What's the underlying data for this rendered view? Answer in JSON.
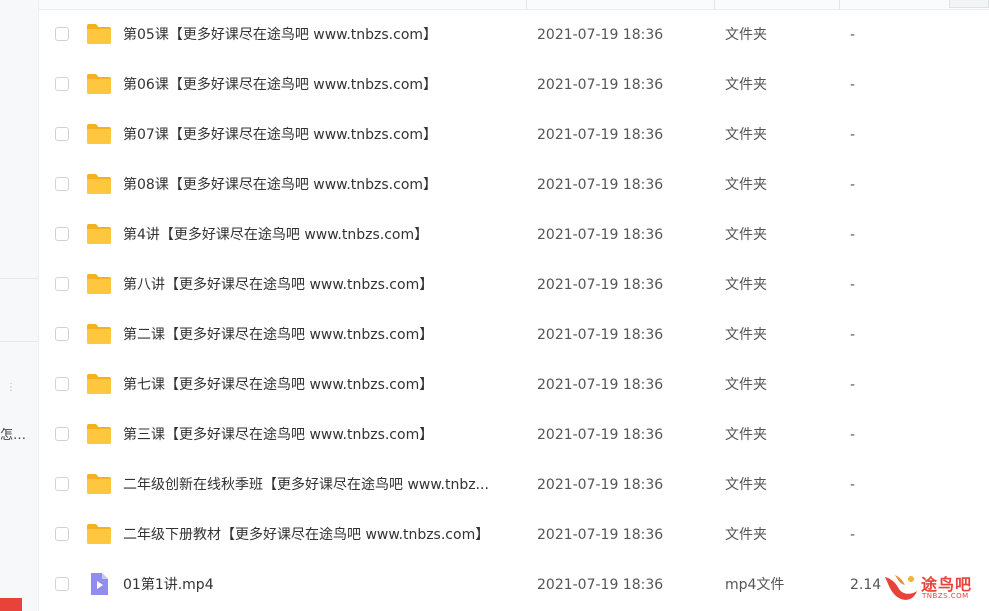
{
  "sidebar": {
    "truncated_text": "怎…"
  },
  "colors": {
    "folder": "#FFC63F",
    "folder_dark": "#F5B21E",
    "video": "#8F8DF0",
    "watermark": "#E8433A"
  },
  "files": [
    {
      "name": "第05课【更多好课尽在途鸟吧 www.tnbzs.com】",
      "date": "2021-07-19 18:36",
      "type": "文件夹",
      "size": "-",
      "icon": "folder-icon"
    },
    {
      "name": "第06课【更多好课尽在途鸟吧 www.tnbzs.com】",
      "date": "2021-07-19 18:36",
      "type": "文件夹",
      "size": "-",
      "icon": "folder-icon"
    },
    {
      "name": "第07课【更多好课尽在途鸟吧 www.tnbzs.com】",
      "date": "2021-07-19 18:36",
      "type": "文件夹",
      "size": "-",
      "icon": "folder-icon"
    },
    {
      "name": "第08课【更多好课尽在途鸟吧 www.tnbzs.com】",
      "date": "2021-07-19 18:36",
      "type": "文件夹",
      "size": "-",
      "icon": "folder-icon"
    },
    {
      "name": "第4讲【更多好课尽在途鸟吧 www.tnbzs.com】",
      "date": "2021-07-19 18:36",
      "type": "文件夹",
      "size": "-",
      "icon": "folder-icon"
    },
    {
      "name": "第八讲【更多好课尽在途鸟吧 www.tnbzs.com】",
      "date": "2021-07-19 18:36",
      "type": "文件夹",
      "size": "-",
      "icon": "folder-icon"
    },
    {
      "name": "第二课【更多好课尽在途鸟吧 www.tnbzs.com】",
      "date": "2021-07-19 18:36",
      "type": "文件夹",
      "size": "-",
      "icon": "folder-icon"
    },
    {
      "name": "第七课【更多好课尽在途鸟吧 www.tnbzs.com】",
      "date": "2021-07-19 18:36",
      "type": "文件夹",
      "size": "-",
      "icon": "folder-icon"
    },
    {
      "name": "第三课【更多好课尽在途鸟吧 www.tnbzs.com】",
      "date": "2021-07-19 18:36",
      "type": "文件夹",
      "size": "-",
      "icon": "folder-icon"
    },
    {
      "name": "二年级创新在线秋季班【更多好课尽在途鸟吧 www.tnbz...",
      "date": "2021-07-19 18:36",
      "type": "文件夹",
      "size": "-",
      "icon": "folder-icon"
    },
    {
      "name": "二年级下册教材【更多好课尽在途鸟吧 www.tnbzs.com】",
      "date": "2021-07-19 18:36",
      "type": "文件夹",
      "size": "-",
      "icon": "folder-icon"
    },
    {
      "name": "01第1讲.mp4",
      "date": "2021-07-19 18:36",
      "type": "mp4文件",
      "size": "2.14",
      "icon": "video-file-icon"
    }
  ],
  "watermark": {
    "text": "途鸟吧",
    "subtext": "TNBZS.COM"
  }
}
